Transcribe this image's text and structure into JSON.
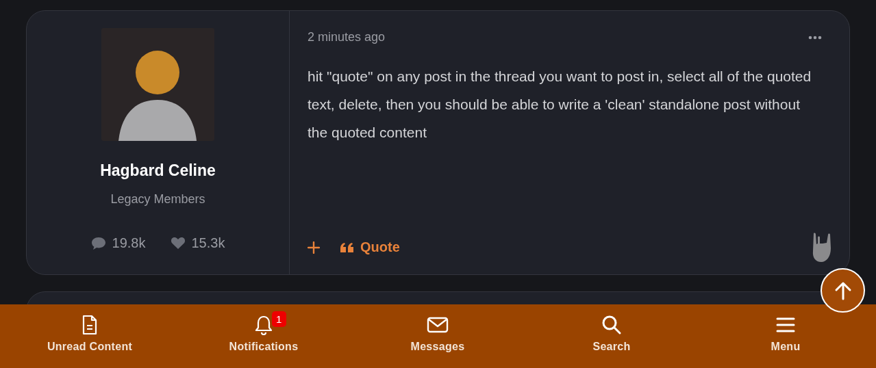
{
  "post": {
    "author": {
      "name": "Hagbard Celine",
      "group": "Legacy Members",
      "posts": "19.8k",
      "likes": "15.3k"
    },
    "time": "2 minutes ago",
    "body": "hit \"quote\" on any post in the thread you want to post in, select all of the quoted text, delete, then you should be able to write a 'clean' standalone post without the quoted content",
    "actions": [
      {
        "label": "Quote"
      }
    ]
  },
  "bottom_nav": [
    {
      "kind": "doc",
      "label": "Unread Content"
    },
    {
      "kind": "bell",
      "label": "Notifications",
      "badge": "1"
    },
    {
      "kind": "mail",
      "label": "Messages"
    },
    {
      "kind": "search",
      "label": "Search"
    },
    {
      "kind": "menu",
      "label": "Menu"
    }
  ]
}
